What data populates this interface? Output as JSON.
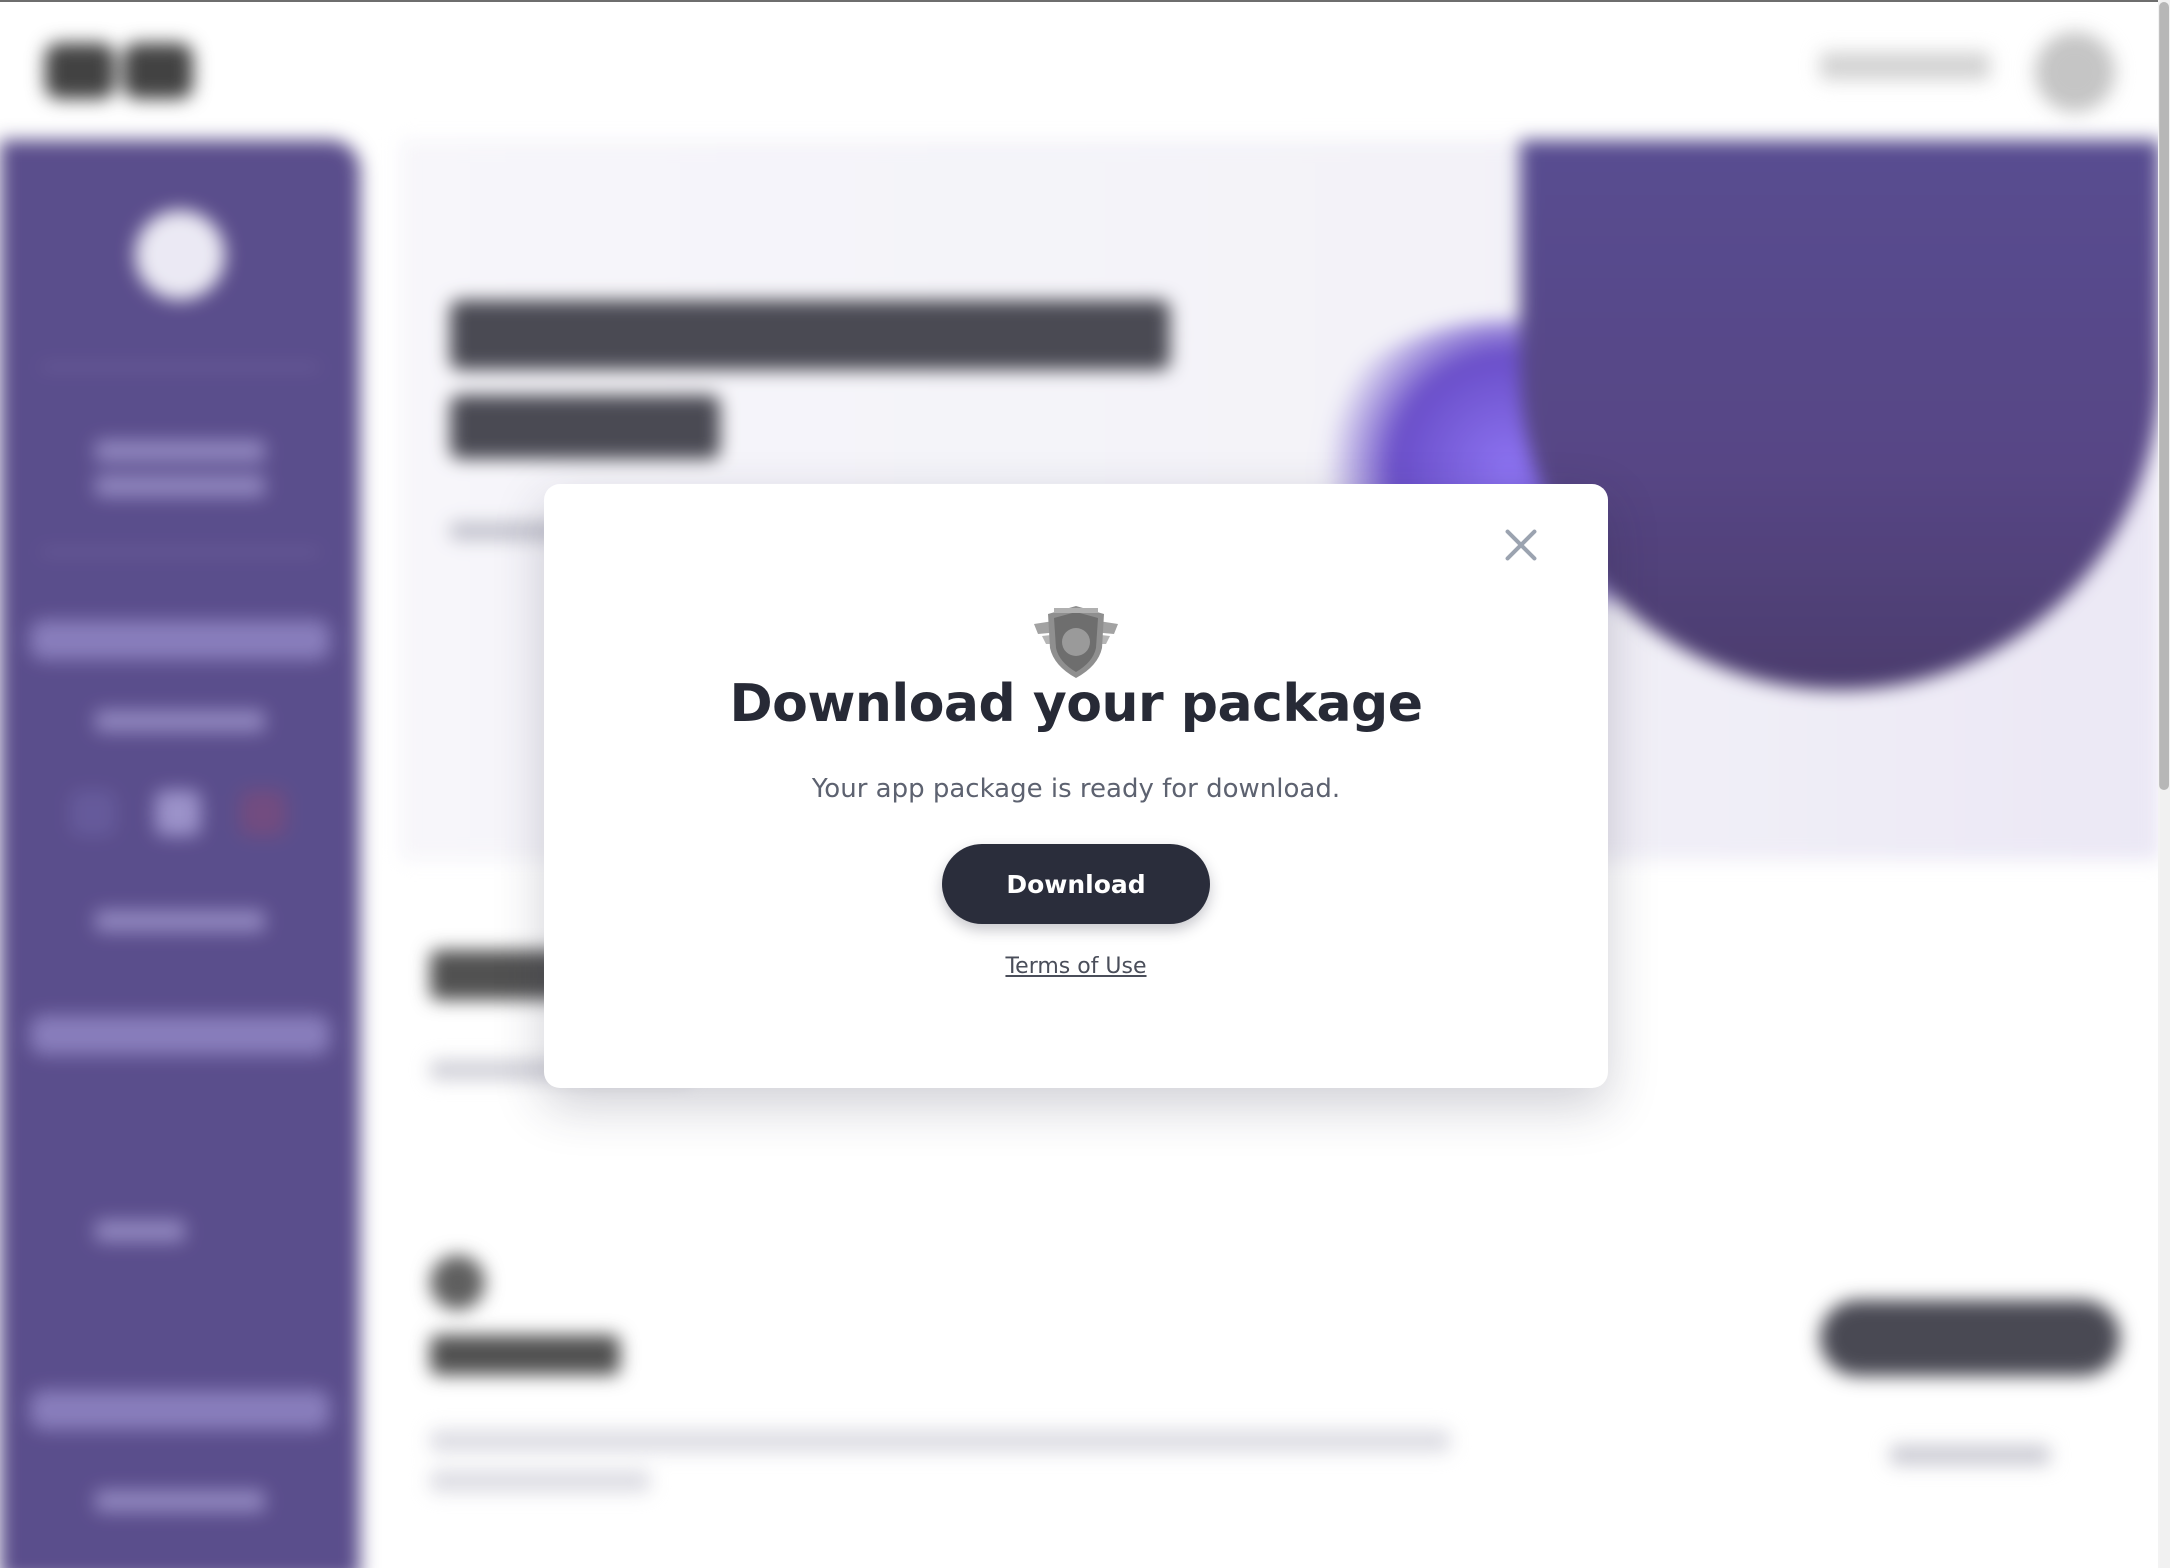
{
  "modal": {
    "title": "Download your package",
    "message": "Your app package is ready for download.",
    "download_label": "Download",
    "terms_link": "Terms of Use",
    "close_icon": "close-icon",
    "badge_icon": "shield-wings-icon"
  },
  "colors": {
    "button_bg": "#2a2d3b",
    "title_text": "#272a36",
    "sidebar_bg": "#3e2f78",
    "hero_accent": "#3b2e7e"
  }
}
